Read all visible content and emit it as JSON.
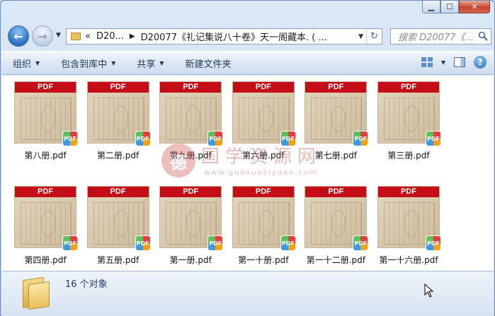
{
  "window": {
    "caption_buttons": [
      "minimize",
      "maximize",
      "close"
    ]
  },
  "address_bar": {
    "prefix": "«",
    "crumbs": [
      "D20...",
      "D20077《礼记集说八十卷》天一阁藏本. ( ..."
    ],
    "search_placeholder": "搜索 D20077《..."
  },
  "toolbar": {
    "organize": "组织",
    "include_in_library": "包含到库中",
    "share": "共享",
    "new_folder": "新建文件夹"
  },
  "files": [
    {
      "name": "第八册.pdf",
      "band": "PDF"
    },
    {
      "name": "第二册.pdf",
      "band": "PDF"
    },
    {
      "name": "第九册.pdf",
      "band": "PDF"
    },
    {
      "name": "第六册.pdf",
      "band": "PDF"
    },
    {
      "name": "第七册.pdf",
      "band": "PDF"
    },
    {
      "name": "第三册.pdf",
      "band": "PDF"
    },
    {
      "name": "第四册.pdf",
      "band": "PDF"
    },
    {
      "name": "第五册.pdf",
      "band": "PDF"
    },
    {
      "name": "第一册.pdf",
      "band": "PDF"
    },
    {
      "name": "第一十册.pdf",
      "band": "PDF"
    },
    {
      "name": "第一十二册.pdf",
      "band": "PDF"
    },
    {
      "name": "第一十六册.pdf",
      "band": "PDF"
    }
  ],
  "badge_text": "PDF",
  "watermark": {
    "logo_char": "德",
    "title": "国学资源网",
    "url": "www.guoxueziyuan.com"
  },
  "status": {
    "count_text": "16 个对象"
  },
  "colors": {
    "pdf_band": "#c40d16",
    "window_frame": "#c4d8ef"
  }
}
